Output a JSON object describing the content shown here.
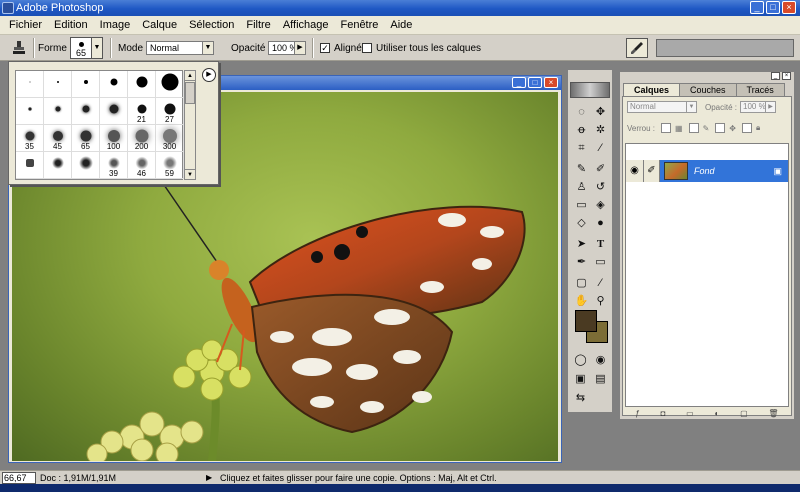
{
  "window": {
    "title": "Adobe Photoshop"
  },
  "menu": [
    "Fichier",
    "Edition",
    "Image",
    "Calque",
    "Sélection",
    "Filtre",
    "Affichage",
    "Fenêtre",
    "Aide"
  ],
  "options": {
    "forme_label": "Forme :",
    "brush_size": "65",
    "mode_label": "Mode :",
    "mode_value": "Normal",
    "opacity_label": "Opacité :",
    "opacity_value": "100 %",
    "aligned_label": "Aligné",
    "all_layers_label": "Utiliser tous les calques"
  },
  "brush_picker": {
    "rows": [
      [
        {
          "n": ""
        },
        {
          "n": ""
        },
        {
          "n": ""
        },
        {
          "n": ""
        },
        {
          "n": ""
        },
        {
          "n": ""
        }
      ],
      [
        {
          "n": ""
        },
        {
          "n": ""
        },
        {
          "n": ""
        },
        {
          "n": ""
        },
        {
          "n": "21"
        },
        {
          "n": "27"
        }
      ],
      [
        {
          "n": "35"
        },
        {
          "n": "45"
        },
        {
          "n": "65"
        },
        {
          "n": "100"
        },
        {
          "n": "200"
        },
        {
          "n": "300"
        }
      ],
      [
        {
          "n": ""
        },
        {
          "n": ""
        },
        {
          "n": ""
        },
        {
          "n": "39"
        },
        {
          "n": "46"
        },
        {
          "n": "59"
        }
      ]
    ]
  },
  "layers_panel": {
    "tabs": [
      "Calques",
      "Couches",
      "Tracés"
    ],
    "blend": "Normal",
    "opacity_label": "Opacité :",
    "opacity_value": "100 %",
    "lock_label": "Verrou :",
    "layer_name": "Fond"
  },
  "status": {
    "zoom": "66,67 %",
    "doc": "Doc : 1,91M/1,91M",
    "hint": "Cliquez et faites glisser pour faire une copie. Options : Maj, Alt et Ctrl."
  },
  "colors": {
    "foreground": "#4a3a22",
    "background": "#7c6d36",
    "selection": "#3274d9"
  }
}
